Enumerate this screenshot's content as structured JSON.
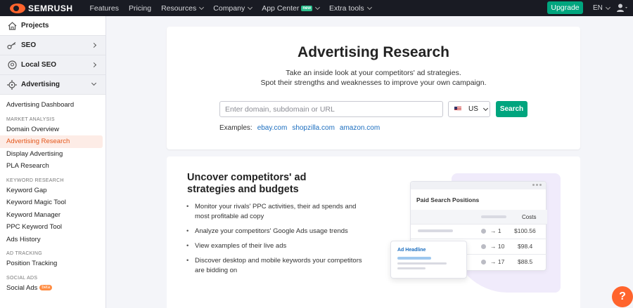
{
  "brand": "SEMRUSH",
  "nav": [
    {
      "label": "Features",
      "has_menu": false
    },
    {
      "label": "Pricing",
      "has_menu": false
    },
    {
      "label": "Resources",
      "has_menu": true
    },
    {
      "label": "Company",
      "has_menu": true
    },
    {
      "label": "App Center",
      "has_menu": true,
      "badge": "new"
    },
    {
      "label": "Extra tools",
      "has_menu": true
    }
  ],
  "topbar": {
    "upgrade_label": "Upgrade",
    "language": "EN"
  },
  "sidebar": {
    "projects": "Projects",
    "seo": "SEO",
    "local_seo": "Local SEO",
    "advertising": "Advertising",
    "dashboard": "Advertising Dashboard",
    "groups": {
      "market_analysis": "MARKET ANALYSIS",
      "keyword_research": "KEYWORD RESEARCH",
      "ad_tracking": "AD TRACKING",
      "social_ads": "SOCIAL ADS"
    },
    "market_items": [
      "Domain Overview",
      "Advertising Research",
      "Display Advertising",
      "PLA Research"
    ],
    "keyword_items": [
      "Keyword Gap",
      "Keyword Magic Tool",
      "Keyword Manager",
      "PPC Keyword Tool",
      "Ads History"
    ],
    "tracking_items": [
      "Position Tracking"
    ],
    "social_items": [
      "Social Ads"
    ],
    "social_badge": "beta",
    "active_item": "Advertising Research"
  },
  "hero": {
    "title": "Advertising Research",
    "subtitle_line1": "Take an inside look at your competitors' ad strategies.",
    "subtitle_line2": "Spot their strengths and weaknesses to improve your own campaign.",
    "search_placeholder": "Enter domain, subdomain or URL",
    "search_value": "",
    "country": "US",
    "search_button": "Search",
    "examples_label": "Examples:",
    "examples": [
      "ebay.com",
      "shopzilla.com",
      "amazon.com"
    ]
  },
  "promo": {
    "heading_line1": "Uncover competitors' ad",
    "heading_line2": "strategies and budgets",
    "bullets": [
      "Monitor your rivals' PPC activities, their ad spends and most profitable ad copy",
      "Analyze your competitors' Google Ads usage trends",
      "View examples of their live ads",
      "Discover desktop and mobile keywords your competitors are bidding on"
    ],
    "illustration": {
      "panel_title": "Paid Search Positions",
      "costs_header": "Costs",
      "rows": [
        {
          "rank": "1",
          "cost": "$100.56"
        },
        {
          "rank": "10",
          "cost": "$98.4"
        },
        {
          "rank": "17",
          "cost": "$88.5"
        }
      ],
      "ad_headline": "Ad Headline"
    }
  },
  "help_label": "?",
  "colors": {
    "accent": "#ff642d",
    "primary_button": "#00a57e",
    "link": "#1a6dbf",
    "topbar": "#191b23"
  }
}
